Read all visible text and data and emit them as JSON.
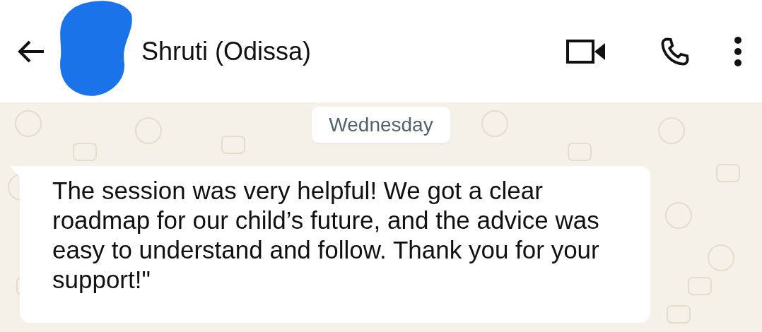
{
  "header": {
    "contact_name": "Shruti (Odissa)"
  },
  "date_chip": "Wednesday",
  "messages": [
    {
      "kind": "incoming",
      "text": "The session was very helpful! We got a clear roadmap for our child’s future, and the advice was easy to understand and follow. Thank you for your support!\""
    }
  ]
}
